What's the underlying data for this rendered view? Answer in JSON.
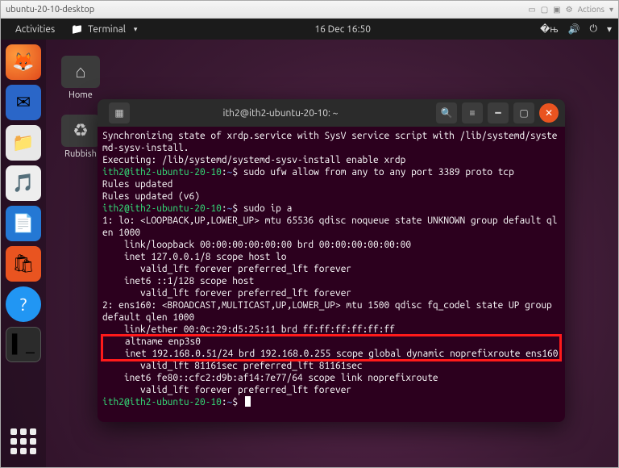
{
  "vm": {
    "title": "ubuntu-20-10-desktop",
    "actions_label": "Actions"
  },
  "topbar": {
    "activities": "Activities",
    "app_menu": "Terminal",
    "datetime": "16 Dec  16:50"
  },
  "desktop": {
    "home": "Home",
    "rubbish": "Rubbish"
  },
  "terminal": {
    "title": "ith2@ith2-ubuntu-20-10: ~",
    "prompt": {
      "user": "ith2",
      "host": "ith2-ubuntu-20-10",
      "path": "~",
      "symbol": "$"
    },
    "lines": {
      "l1": "Synchronizing state of xrdp.service with SysV service script with /lib/systemd/systemd-sysv-install.",
      "l2": "Executing: /lib/systemd/systemd-sysv-install enable xrdp",
      "cmd1": "sudo ufw allow from any to any port 3389 proto tcp",
      "l3": "Rules updated",
      "l4": "Rules updated (v6)",
      "cmd2": "sudo ip a",
      "l5": "1: lo: <LOOPBACK,UP,LOWER_UP> mtu 65536 qdisc noqueue state UNKNOWN group default qlen 1000",
      "l6": "    link/loopback 00:00:00:00:00:00 brd 00:00:00:00:00:00",
      "l7": "    inet 127.0.0.1/8 scope host lo",
      "l8": "       valid_lft forever preferred_lft forever",
      "l9": "    inet6 ::1/128 scope host",
      "l10": "       valid_lft forever preferred_lft forever",
      "l11": "2: ens160: <BROADCAST,MULTICAST,UP,LOWER_UP> mtu 1500 qdisc fq_codel state UP group default qlen 1000",
      "l12": "    link/ether 00:0c:29:d5:25:11 brd ff:ff:ff:ff:ff:ff",
      "hlA": "    altname enp3s0",
      "hlB": "    inet 192.168.0.51/24 brd 192.168.0.255 scope global dynamic noprefixroute ens160",
      "l13": "       valid_lft 81161sec preferred_lft 81161sec",
      "l14": "    inet6 fe80::cfc2:d9b:af14:7e77/64 scope link noprefixroute",
      "l15": "       valid_lft forever preferred_lft forever"
    }
  }
}
